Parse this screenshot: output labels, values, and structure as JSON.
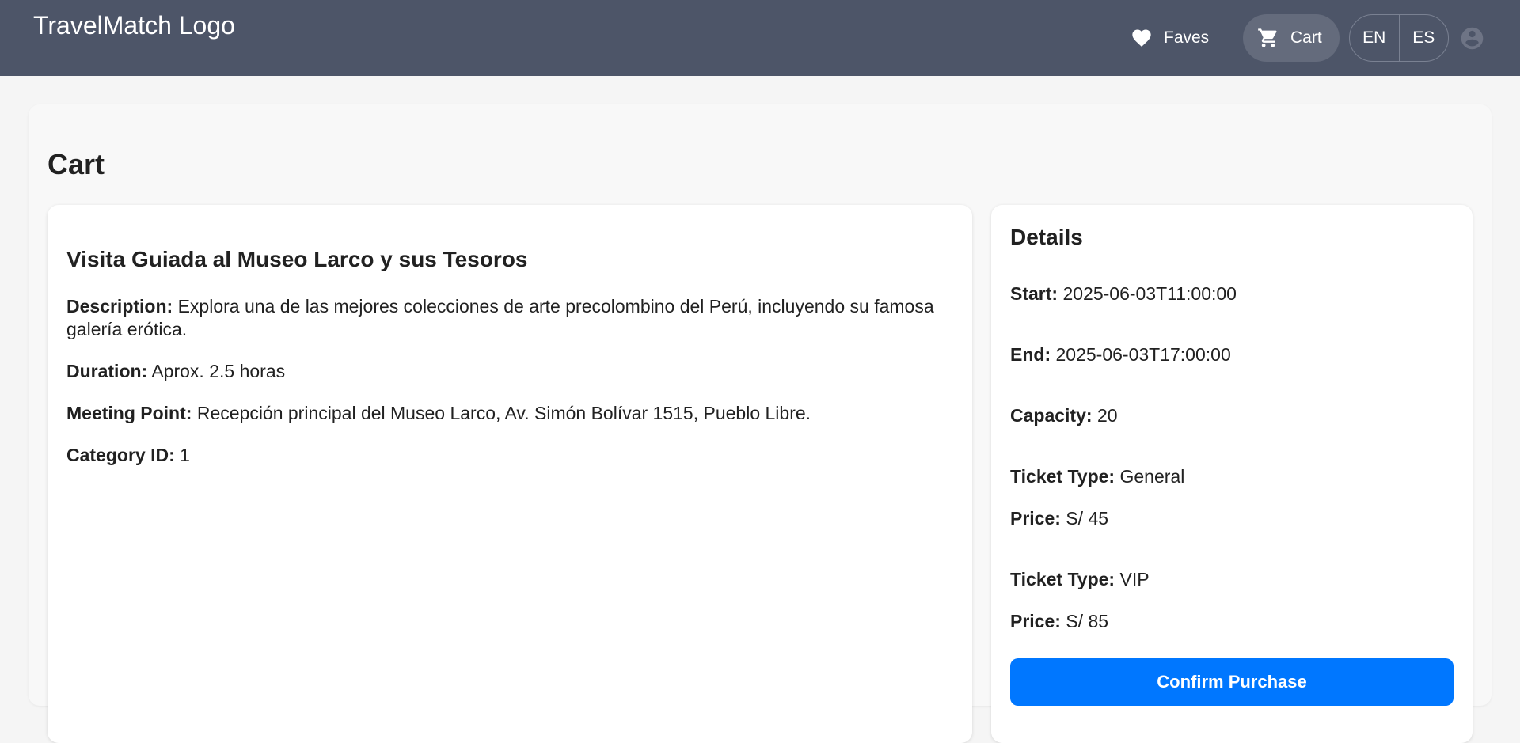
{
  "header": {
    "logo": "TravelMatch Logo",
    "faves_label": "Faves",
    "cart_label": "Cart",
    "languages": [
      "EN",
      "ES"
    ]
  },
  "page": {
    "title": "Cart"
  },
  "activity": {
    "title": "Visita Guiada al Museo Larco y sus Tesoros",
    "description_label": "Description:",
    "description": "Explora una de las mejores colecciones de arte precolombino del Perú, incluyendo su famosa galería erótica.",
    "duration_label": "Duration:",
    "duration": "Aprox. 2.5 horas",
    "meeting_point_label": "Meeting Point:",
    "meeting_point": "Recepción principal del Museo Larco, Av. Simón Bolívar 1515, Pueblo Libre.",
    "category_label": "Category ID:",
    "category_id": "1"
  },
  "details": {
    "title": "Details",
    "start_label": "Start:",
    "start": "2025-06-03T11:00:00",
    "end_label": "End:",
    "end": "2025-06-03T17:00:00",
    "capacity_label": "Capacity:",
    "capacity": "20",
    "tickets": [
      {
        "type_label": "Ticket Type:",
        "type": "General",
        "price_label": "Price:",
        "price": "S/ 45"
      },
      {
        "type_label": "Ticket Type:",
        "type": "VIP",
        "price_label": "Price:",
        "price": "S/ 85"
      }
    ],
    "confirm_label": "Confirm Purchase"
  },
  "colors": {
    "header_bg": "#4d5568",
    "primary": "#0077ff"
  }
}
